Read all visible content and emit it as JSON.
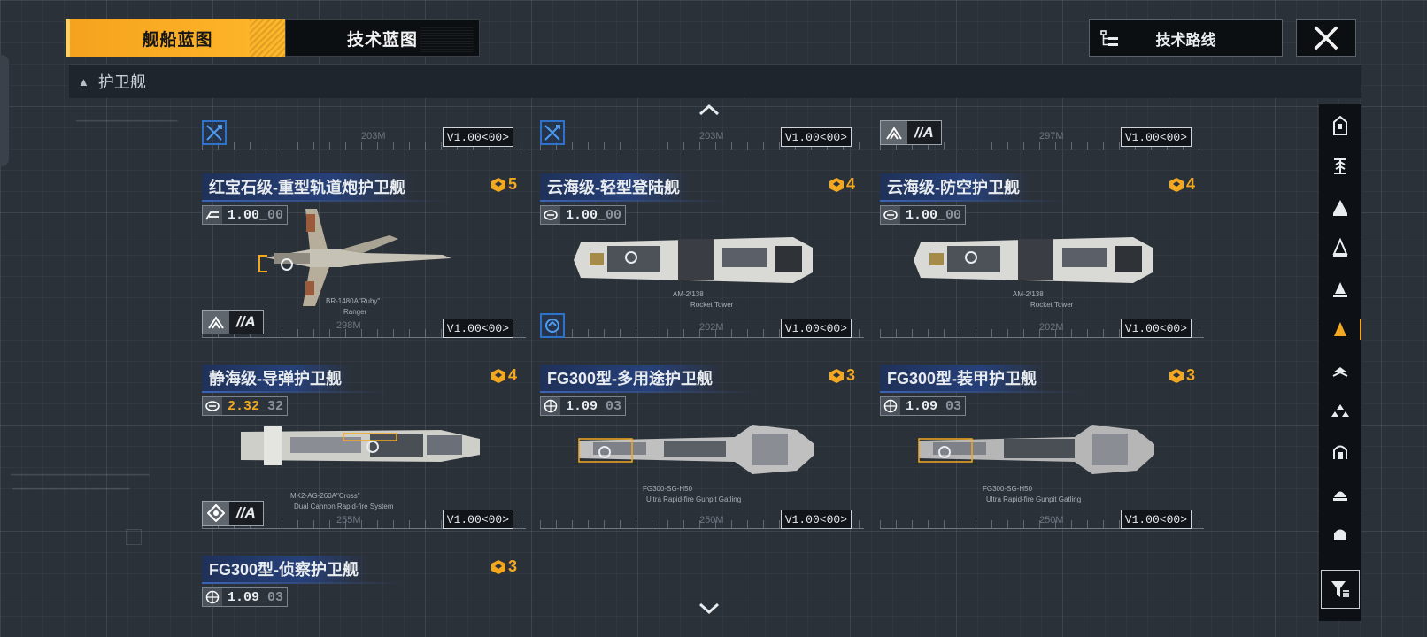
{
  "tabs": {
    "active": "舰船蓝图",
    "inactive": "技术蓝图"
  },
  "route_button": "技术路线",
  "category": "护卫舰",
  "top_partial": [
    {
      "length": "203M",
      "version": "V1.00<00>",
      "has_rank": false
    },
    {
      "length": "203M",
      "version": "V1.00<00>",
      "has_rank": false
    },
    {
      "length": "297M",
      "version": "V1.00<00>",
      "rank": "//A"
    }
  ],
  "cards": [
    {
      "title": "红宝石级-重型轨道炮护卫舰",
      "cost": "5",
      "stat_main": "1.00",
      "stat_dim": "_00",
      "stat_gold": false,
      "rank": "//A",
      "version": "V1.00<00>",
      "length": "298M",
      "weapon": "BR-1480A\"Ruby\"",
      "weapon_sub": "Ranger"
    },
    {
      "title": "云海级-轻型登陆舰",
      "cost": "4",
      "stat_main": "1.00",
      "stat_dim": "_00",
      "stat_gold": false,
      "version": "V1.00<00>",
      "length": "202M",
      "weapon": "AM-2/138",
      "weapon_sub": "Rocket Tower"
    },
    {
      "title": "云海级-防空护卫舰",
      "cost": "4",
      "stat_main": "1.00",
      "stat_dim": "_00",
      "stat_gold": false,
      "version": "V1.00<00>",
      "length": "202M",
      "weapon": "AM-2/138",
      "weapon_sub": "Rocket Tower"
    },
    {
      "title": "静海级-导弹护卫舰",
      "cost": "4",
      "stat_main": "2.32",
      "stat_dim": "_32",
      "stat_gold": true,
      "rank": "//A",
      "version": "V1.00<00>",
      "length": "255M",
      "weapon": "MK2-AG-260A\"Cross\"",
      "weapon_sub": "Dual Cannon Rapid-fire System"
    },
    {
      "title": "FG300型-多用途护卫舰",
      "cost": "3",
      "stat_main": "1.09",
      "stat_dim": "_03",
      "stat_gold": false,
      "version": "V1.00<00>",
      "length": "250M",
      "weapon": "FG300-SG-H50",
      "weapon_sub": "Ultra Rapid-fire Gunpit Gatling"
    },
    {
      "title": "FG300型-装甲护卫舰",
      "cost": "3",
      "stat_main": "1.09",
      "stat_dim": "_03",
      "stat_gold": false,
      "version": "V1.00<00>",
      "length": "250M",
      "weapon": "FG300-SG-H50",
      "weapon_sub": "Ultra Rapid-fire Gunpit Gatling"
    },
    {
      "title": "FG300型-侦察护卫舰",
      "cost": "3",
      "stat_main": "1.09",
      "stat_dim": "_03",
      "stat_gold": false
    }
  ],
  "colors": {
    "accent": "#f3a81f",
    "title_bg": "#26407a",
    "role_blue": "#2e72c9"
  },
  "icons": [
    "role-icon",
    "rank-icon",
    "cost-icon",
    "stat-icon",
    "sidebar-class-icon",
    "filter-icon",
    "close-icon",
    "route-icon",
    "chevron-up-icon",
    "chevron-down-icon"
  ]
}
